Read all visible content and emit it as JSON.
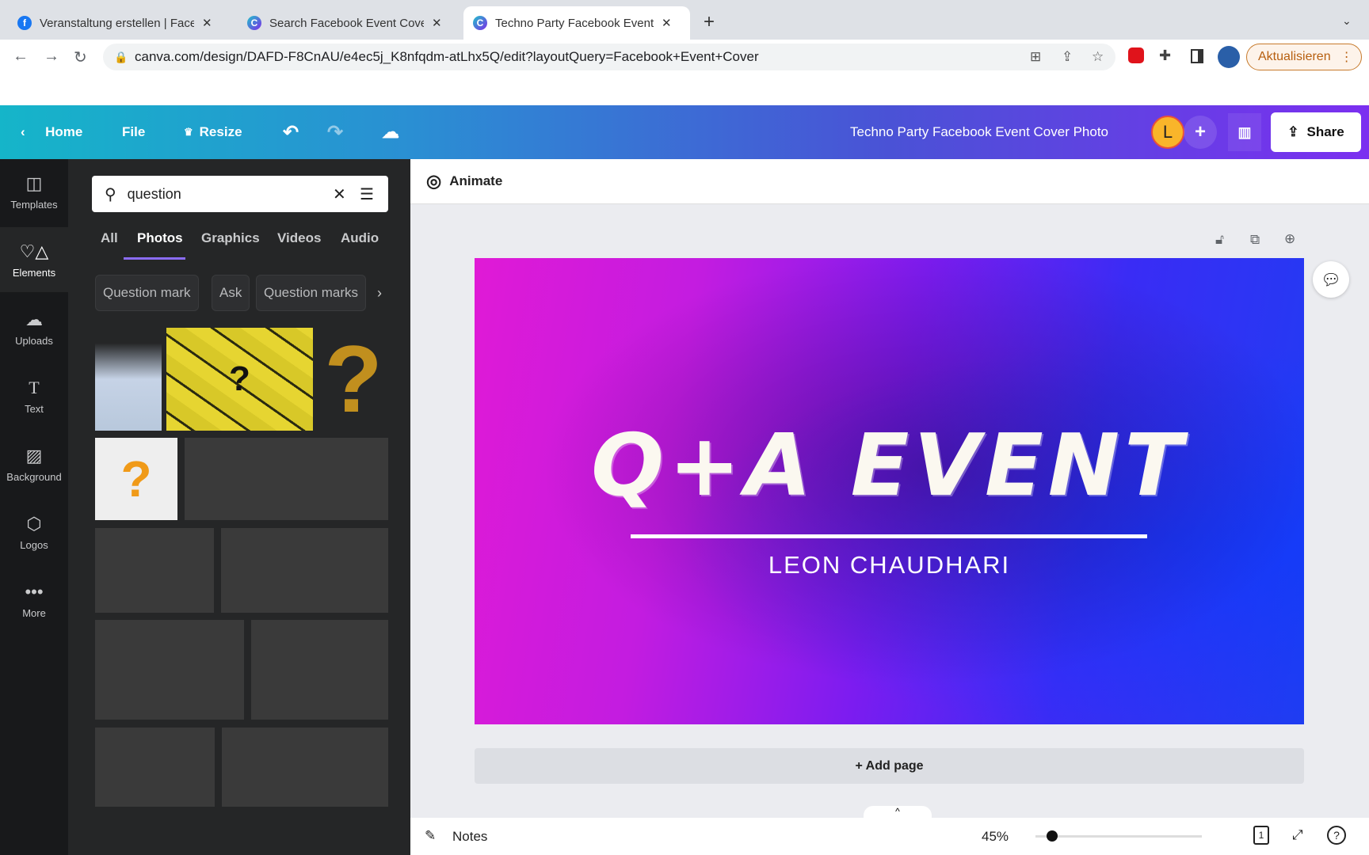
{
  "browser": {
    "tabs": [
      {
        "title": "Veranstaltung erstellen | Facebook",
        "icon": "facebook-icon",
        "active": false
      },
      {
        "title": "Search Facebook Event Cover - Canva",
        "icon": "canva-icon",
        "active": false
      },
      {
        "title": "Techno Party Facebook Event Cover",
        "icon": "canva-icon",
        "active": true
      }
    ],
    "url": "canva.com/design/DAFD-F8CnAU/e4ec5j_K8nfqdm-atLhx5Q/edit?layoutQuery=Facebook+Event+Cover",
    "update_button": "Aktualisieren"
  },
  "header": {
    "home": "Home",
    "file": "File",
    "resize": "Resize",
    "doc_title": "Techno Party Facebook Event Cover Photo",
    "avatar": "L",
    "share": "Share",
    "accent": "#7b2ff0"
  },
  "rail": [
    {
      "label": "Templates",
      "icon": "templates-icon"
    },
    {
      "label": "Elements",
      "icon": "elements-icon",
      "selected": true
    },
    {
      "label": "Uploads",
      "icon": "upload-cloud-icon"
    },
    {
      "label": "Text",
      "icon": "text-icon"
    },
    {
      "label": "Background",
      "icon": "background-icon"
    },
    {
      "label": "Logos",
      "icon": "logos-icon"
    },
    {
      "label": "More",
      "icon": "more-icon"
    }
  ],
  "panel": {
    "search_value": "question",
    "tabs": [
      "All",
      "Photos",
      "Graphics",
      "Videos",
      "Audio"
    ],
    "active_tab": "Photos",
    "chips": [
      "Question mark",
      "Ask",
      "Question marks"
    ]
  },
  "toolbar": {
    "animate": "Animate"
  },
  "design": {
    "title": "Q+A EVENT",
    "subtitle": "LEON CHAUDHARI"
  },
  "add_page": "+ Add page",
  "footer": {
    "notes": "Notes",
    "zoom": "45%",
    "zoom_level": 45,
    "page": "1"
  }
}
